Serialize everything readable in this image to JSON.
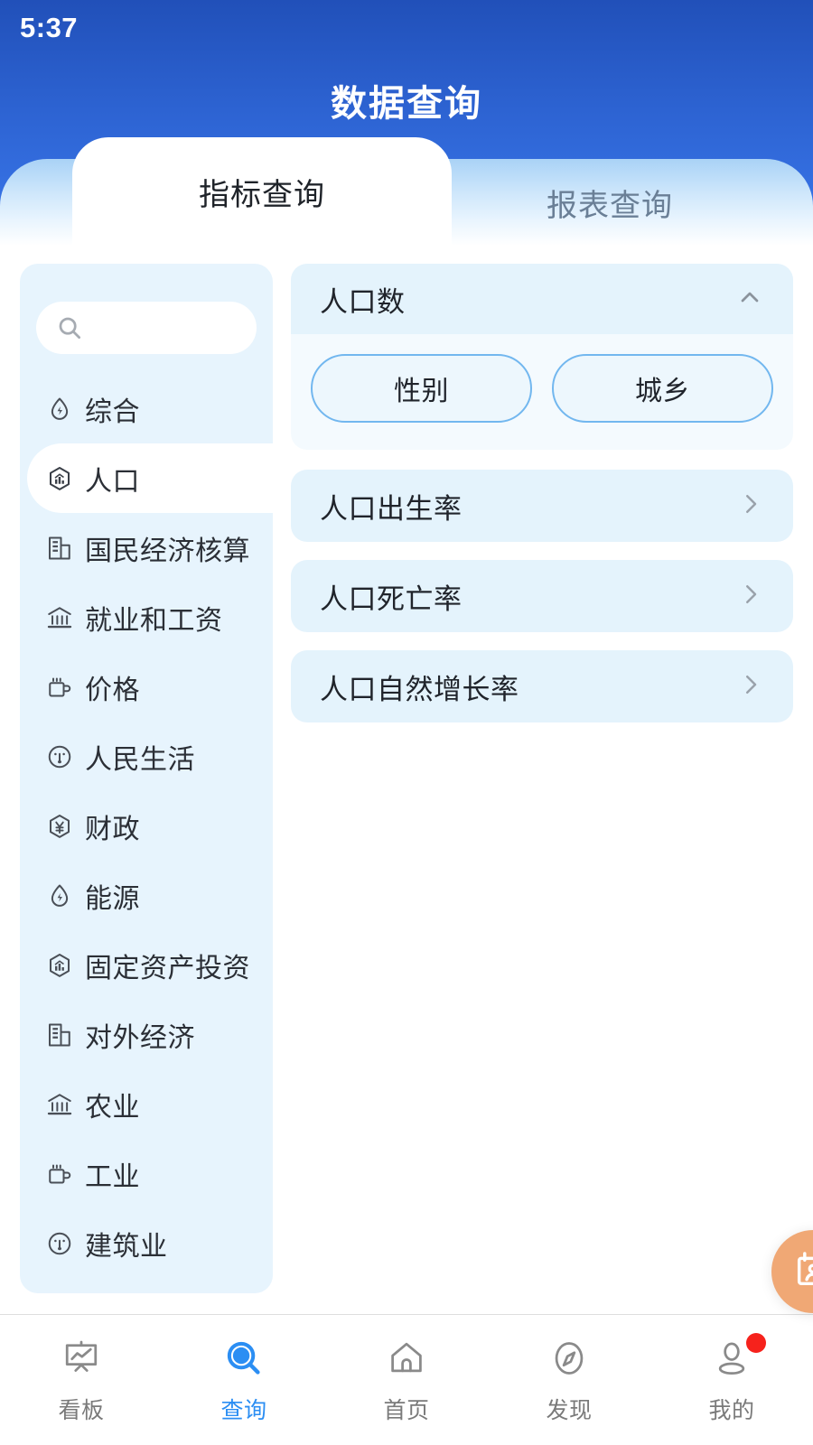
{
  "status": {
    "time": "5:37"
  },
  "header": {
    "title": "数据查询",
    "tabs": [
      {
        "label": "指标查询",
        "active": true
      },
      {
        "label": "报表查询",
        "active": false
      }
    ]
  },
  "sidebar": {
    "search": {
      "placeholder": "",
      "value": "",
      "icon": "search-icon"
    },
    "items": [
      {
        "label": "综合",
        "icon": "droplet-bolt-icon",
        "active": false
      },
      {
        "label": "人口",
        "icon": "hexagon-chart-icon",
        "active": true
      },
      {
        "label": "国民经济核算",
        "icon": "building-chart-icon",
        "active": false
      },
      {
        "label": "就业和工资",
        "icon": "bank-icon",
        "active": false
      },
      {
        "label": "价格",
        "icon": "mug-icon",
        "active": false
      },
      {
        "label": "人民生活",
        "icon": "gauge-icon",
        "active": false
      },
      {
        "label": "财政",
        "icon": "hexagon-yuan-icon",
        "active": false
      },
      {
        "label": "能源",
        "icon": "droplet-bolt-icon",
        "active": false
      },
      {
        "label": "固定资产投资",
        "icon": "hexagon-chart-icon",
        "active": false
      },
      {
        "label": "对外经济",
        "icon": "building-chart-icon",
        "active": false
      },
      {
        "label": "农业",
        "icon": "bank-icon",
        "active": false
      },
      {
        "label": "工业",
        "icon": "mug-icon",
        "active": false
      },
      {
        "label": "建筑业",
        "icon": "gauge-icon",
        "active": false
      }
    ]
  },
  "content": {
    "expanded_card": {
      "title": "人口数",
      "toggle_icon": "chevron-up-icon",
      "chips": [
        {
          "label": "性别"
        },
        {
          "label": "城乡"
        }
      ]
    },
    "rows": [
      {
        "label": "人口出生率",
        "icon": "chevron-right-icon"
      },
      {
        "label": "人口死亡率",
        "icon": "chevron-right-icon"
      },
      {
        "label": "人口自然增长率",
        "icon": "chevron-right-icon"
      }
    ]
  },
  "fab": {
    "icon": "report-person-icon"
  },
  "bottom_nav": {
    "items": [
      {
        "label": "看板",
        "icon": "board-chart-icon",
        "active": false,
        "badge": false
      },
      {
        "label": "查询",
        "icon": "search-filled-icon",
        "active": true,
        "badge": false
      },
      {
        "label": "首页",
        "icon": "home-icon",
        "active": false,
        "badge": false
      },
      {
        "label": "发现",
        "icon": "compass-icon",
        "active": false,
        "badge": false
      },
      {
        "label": "我的",
        "icon": "user-icon",
        "active": false,
        "badge": true
      }
    ]
  },
  "colors": {
    "header_top": "#2150b9",
    "header_bottom": "#3a78ec",
    "sidebar_bg": "#e7f4fd",
    "card_head": "#e4f3fc",
    "card_body": "#f4fafe",
    "chip_border": "#72b7ef",
    "accent": "#2b8ef3",
    "fab": "#f0a875",
    "badge": "#f6221c"
  }
}
